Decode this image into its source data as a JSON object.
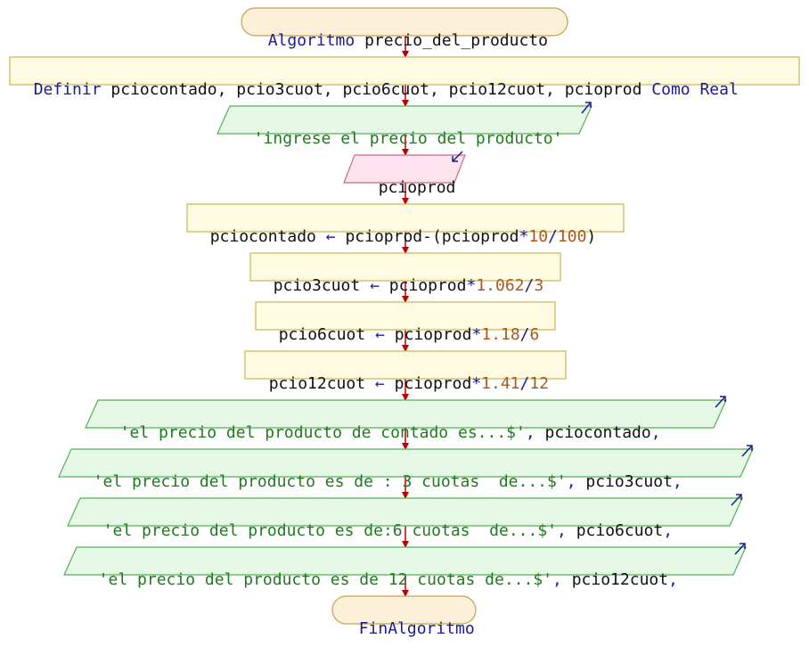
{
  "title": {
    "keyword": "Algoritmo",
    "name": "precio_del_producto"
  },
  "define": {
    "keyword": "Definir",
    "vars": "pciocontado, pcio3cuot, pcio6cuot, pcio12cuot, pcioprod",
    "type_keyword": "Como Real"
  },
  "prompt": {
    "text": "'ingrese el precio del producto'"
  },
  "read": {
    "var": "pcioprod"
  },
  "assign1": {
    "target": "pciocontado",
    "arrow": "←",
    "expr_a": "pcioprod-(pcioprod",
    "op1": "*",
    "n1": "10",
    "op2": "/",
    "n2": "100",
    "close": ")"
  },
  "assign2": {
    "target": "pcio3cuot",
    "arrow": "←",
    "expr_a": "pcioprod",
    "op1": "*",
    "n1": "1.062",
    "op2": "/",
    "n2": "3"
  },
  "assign3": {
    "target": "pcio6cuot",
    "arrow": "←",
    "expr_a": "pcioprod",
    "op1": "*",
    "n1": "1.18",
    "op2": "/",
    "n2": "6"
  },
  "assign4": {
    "target": "pcio12cuot",
    "arrow": "←",
    "expr_a": "pcioprod",
    "op1": "*",
    "n1": "1.41",
    "op2": "/",
    "n2": "12"
  },
  "out1": {
    "str": "'el precio del producto de contado es...$'",
    "sep": ",",
    "var": " pciocontado",
    "end": ","
  },
  "out2": {
    "str": "'el precio del producto es de : 3 cuotas  de...$'",
    "sep": ",",
    "var": " pcio3cuot",
    "end": ","
  },
  "out3": {
    "str": "'el precio del producto es de:6 cuotas  de...$'",
    "sep": ",",
    "var": " pcio6cuot",
    "end": ","
  },
  "out4": {
    "str": "'el precio del producto es de 12 cuotas de...$'",
    "sep": ",",
    "var": " pcio12cuot",
    "end": ","
  },
  "end": {
    "keyword": "FinAlgoritmo"
  },
  "colors": {
    "terminal_fill": "#fdf0d8",
    "terminal_stroke": "#c8a050",
    "process_fill": "#fffbe2",
    "process_stroke": "#c9b850",
    "io_fill": "#e6f8e6",
    "io_stroke": "#55b055",
    "input_fill": "#fde3ee",
    "input_stroke": "#c86a8c",
    "arrow": "#bb0000",
    "corner_arrow": "#1b1b8f"
  },
  "icons": {
    "output_marker": "arrow-up-right-icon",
    "input_marker": "arrow-down-left-icon"
  }
}
